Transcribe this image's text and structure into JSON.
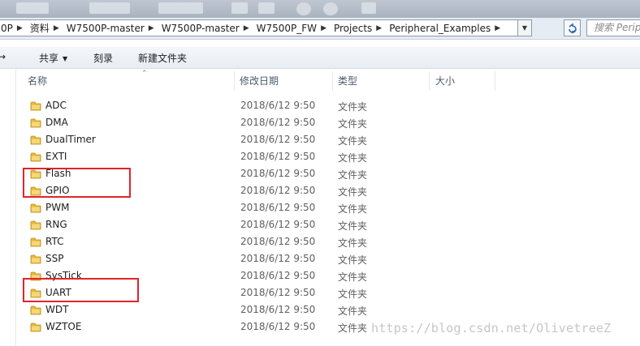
{
  "address_bar": {
    "crumbs": [
      "0P",
      "资料",
      "W7500P-master",
      "W7500P-master",
      "W7500P_FW",
      "Projects",
      "Peripheral_Examples"
    ],
    "search_placeholder": "搜索 Peripheral_Examples"
  },
  "toolbar": {
    "left_partial": "→",
    "share": "共享",
    "burn": "刻录",
    "new_folder": "新建文件夹"
  },
  "columns": {
    "name": "名称",
    "date": "修改日期",
    "type": "类型",
    "size": "大小"
  },
  "rows": [
    {
      "name": "ADC",
      "date": "2018/6/12 9:50",
      "type": "文件夹"
    },
    {
      "name": "DMA",
      "date": "2018/6/12 9:50",
      "type": "文件夹"
    },
    {
      "name": "DualTimer",
      "date": "2018/6/12 9:50",
      "type": "文件夹"
    },
    {
      "name": "EXTI",
      "date": "2018/6/12 9:50",
      "type": "文件夹"
    },
    {
      "name": "Flash",
      "date": "2018/6/12 9:50",
      "type": "文件夹"
    },
    {
      "name": "GPIO",
      "date": "2018/6/12 9:50",
      "type": "文件夹"
    },
    {
      "name": "PWM",
      "date": "2018/6/12 9:50",
      "type": "文件夹"
    },
    {
      "name": "RNG",
      "date": "2018/6/12 9:50",
      "type": "文件夹"
    },
    {
      "name": "RTC",
      "date": "2018/6/12 9:50",
      "type": "文件夹"
    },
    {
      "name": "SSP",
      "date": "2018/6/12 9:50",
      "type": "文件夹"
    },
    {
      "name": "SysTick",
      "date": "2018/6/12 9:50",
      "type": "文件夹"
    },
    {
      "name": "UART",
      "date": "2018/6/12 9:50",
      "type": "文件夹"
    },
    {
      "name": "WDT",
      "date": "2018/6/12 9:50",
      "type": "文件夹"
    },
    {
      "name": "WZTOE",
      "date": "2018/6/12 9:50",
      "type": "文件夹"
    }
  ],
  "watermark": "https://blog.csdn.net/OlivetreeZ",
  "colors": {
    "highlight": "#e0242b",
    "folder": "#e8b93a"
  }
}
